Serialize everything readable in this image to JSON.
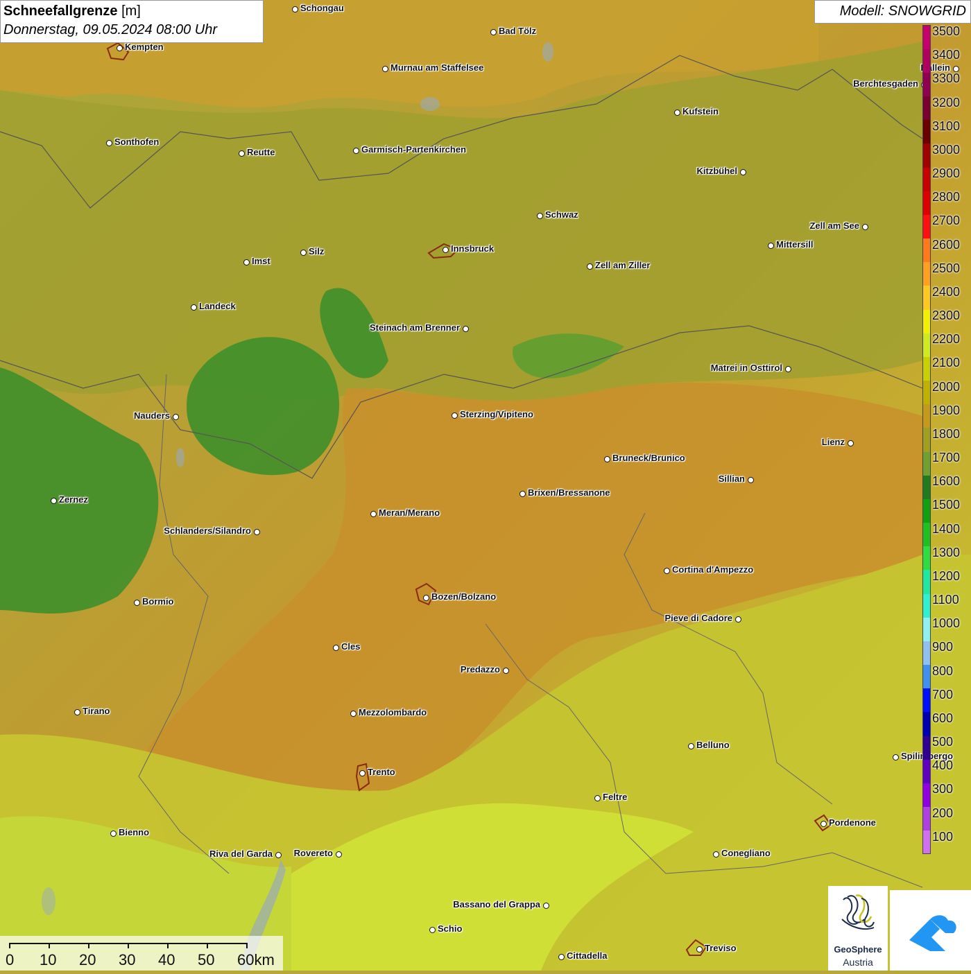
{
  "title": {
    "main": "Schneefallgrenze",
    "unit": "[m]",
    "datetime": "Donnerstag, 09.05.2024 08:00 Uhr"
  },
  "model_label": "Modell: SNOWGRID",
  "legend": {
    "labels": [
      "3500",
      "3400",
      "3300",
      "3200",
      "3100",
      "3000",
      "2900",
      "2800",
      "2700",
      "2600",
      "2500",
      "2400",
      "2300",
      "2200",
      "2100",
      "2000",
      "1900",
      "1800",
      "1700",
      "1600",
      "1500",
      "1400",
      "1300",
      "1200",
      "1100",
      "1000",
      "900",
      "800",
      "700",
      "600",
      "500",
      "400",
      "300",
      "200",
      "100"
    ],
    "colors": [
      "#c8006e",
      "#b00060",
      "#900050",
      "#7a0030",
      "#6a0000",
      "#a00000",
      "#c80000",
      "#e00000",
      "#ff1010",
      "#ff7a1a",
      "#ffa020",
      "#ffc820",
      "#f0f000",
      "#d0ea20",
      "#c8d000",
      "#c0b000",
      "#c49a18",
      "#a0a020",
      "#70a030",
      "#207a20",
      "#10a010",
      "#20c020",
      "#30dd40",
      "#20e8a0",
      "#30f0d0",
      "#90f0f0",
      "#90c0f0",
      "#4090f0",
      "#0010ff",
      "#0000b0",
      "#300090",
      "#6000c0",
      "#9000e0",
      "#b040e0",
      "#d070f0"
    ]
  },
  "cities": [
    {
      "name": "Schongau"
    },
    {
      "name": "Kempten"
    },
    {
      "name": "Bad Tölz"
    },
    {
      "name": "Murnau am Staffelsee"
    },
    {
      "name": "Hallein"
    },
    {
      "name": "Berchtesgaden"
    },
    {
      "name": "Kufstein"
    },
    {
      "name": "Sonthofen"
    },
    {
      "name": "Reutte"
    },
    {
      "name": "Garmisch-Partenkirchen"
    },
    {
      "name": "Kitzbühel"
    },
    {
      "name": "Schwaz"
    },
    {
      "name": "Zell am See"
    },
    {
      "name": "Innsbruck"
    },
    {
      "name": "Mittersill"
    },
    {
      "name": "Silz"
    },
    {
      "name": "Imst"
    },
    {
      "name": "Zell am Ziller"
    },
    {
      "name": "Landeck"
    },
    {
      "name": "Steinach am Brenner"
    },
    {
      "name": "Matrei in Osttirol"
    },
    {
      "name": "Nauders"
    },
    {
      "name": "Sterzing/Vipiteno"
    },
    {
      "name": "Lienz"
    },
    {
      "name": "Bruneck/Brunico"
    },
    {
      "name": "Sillian"
    },
    {
      "name": "Zernez"
    },
    {
      "name": "Brixen/Bressanone"
    },
    {
      "name": "Meran/Merano"
    },
    {
      "name": "Schlanders/Silandro"
    },
    {
      "name": "Cortina d'Ampezzo"
    },
    {
      "name": "Bozen/Bolzano"
    },
    {
      "name": "Bormio"
    },
    {
      "name": "Pieve di Cadore"
    },
    {
      "name": "Cles"
    },
    {
      "name": "Predazzo"
    },
    {
      "name": "Tirano"
    },
    {
      "name": "Mezzolombardo"
    },
    {
      "name": "Belluno"
    },
    {
      "name": "Spilimbergo"
    },
    {
      "name": "Trento"
    },
    {
      "name": "Feltre"
    },
    {
      "name": "Pordenone"
    },
    {
      "name": "Bienno"
    },
    {
      "name": "Riva del Garda"
    },
    {
      "name": "Rovereto"
    },
    {
      "name": "Conegliano"
    },
    {
      "name": "Bassano del Grappa"
    },
    {
      "name": "Schio"
    },
    {
      "name": "Treviso"
    },
    {
      "name": "Cittadella"
    }
  ],
  "scalebar": {
    "labels": [
      "0",
      "10",
      "20",
      "30",
      "40",
      "50",
      "60km"
    ]
  },
  "logos": {
    "geosphere_line1": "GeoSphere",
    "geosphere_line2": "Austria"
  }
}
